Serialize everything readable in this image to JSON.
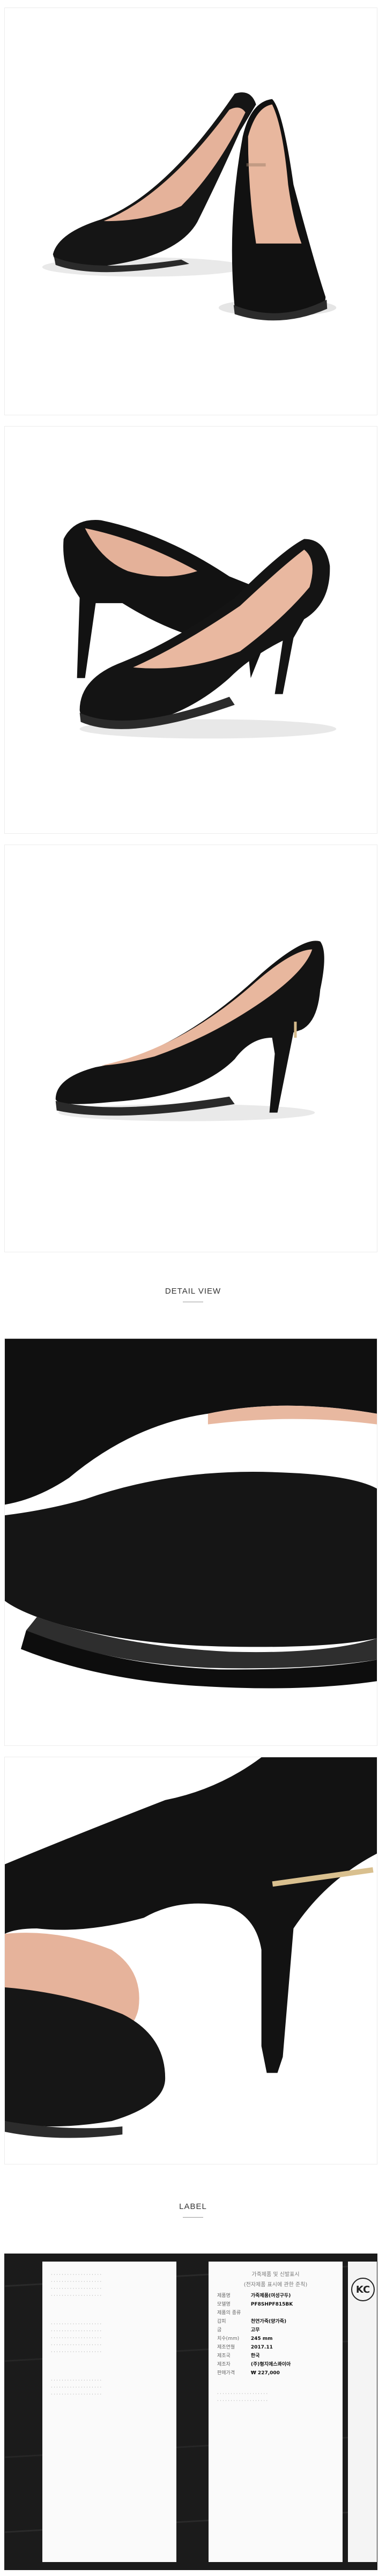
{
  "sections": {
    "detail_view_title": "DETAIL VIEW",
    "label_title": "LABEL"
  },
  "product_label": {
    "header": [
      "가죽제품 및 신발표시",
      "(전자제품 표시에 관한 준칙)"
    ],
    "rows": [
      {
        "key": "제품명",
        "value": "가죽제품(여성구두)"
      },
      {
        "key": "모델명",
        "value": "PF8SHPF815BK"
      },
      {
        "key": "제품의 종류",
        "value": ""
      },
      {
        "key": "갑피",
        "value": "천연가죽(양가죽)"
      },
      {
        "key": "굽",
        "value": "고무"
      },
      {
        "key": "치수(mm)",
        "value": "245 mm"
      },
      {
        "key": "제조연월",
        "value": "2017.11"
      },
      {
        "key": "제조국",
        "value": "한국"
      },
      {
        "key": "제조자",
        "value": "(주)형지에스콰이아"
      },
      {
        "key": "판매가격",
        "value": "₩ 227,000"
      }
    ],
    "certification_mark": "KC"
  },
  "colors": {
    "leather": "#141414",
    "lining": "#e8b79e",
    "metal_trim": "#d4b98a",
    "rule": "#999999"
  }
}
